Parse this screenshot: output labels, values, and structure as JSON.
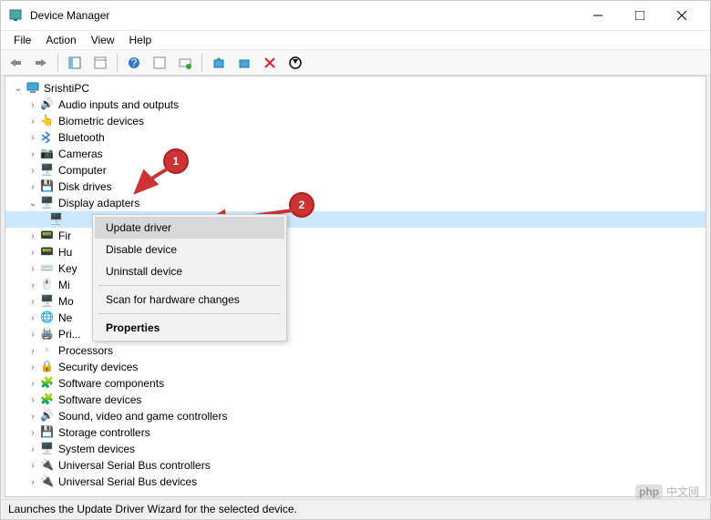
{
  "window": {
    "title": "Device Manager"
  },
  "menu": {
    "file": "File",
    "action": "Action",
    "view": "View",
    "help": "Help"
  },
  "tree": {
    "root": "SrishtiPC",
    "items": [
      "Audio inputs and outputs",
      "Biometric devices",
      "Bluetooth",
      "Cameras",
      "Computer",
      "Disk drives",
      "Display adapters",
      "Fir",
      "Hu",
      "Key",
      "Mi",
      "Mo",
      "Ne",
      "Pri",
      "Processors",
      "Security devices",
      "Software components",
      "Software devices",
      "Sound, video and game controllers",
      "Storage controllers",
      "System devices",
      "Universal Serial Bus controllers",
      "Universal Serial Bus devices"
    ],
    "truncated_suffix": "..."
  },
  "context_menu": {
    "update": "Update driver",
    "disable": "Disable device",
    "uninstall": "Uninstall device",
    "scan": "Scan for hardware changes",
    "properties": "Properties"
  },
  "badges": {
    "one": "1",
    "two": "2"
  },
  "statusbar": {
    "text": "Launches the Update Driver Wizard for the selected device."
  },
  "watermark": {
    "text": "中文网"
  }
}
